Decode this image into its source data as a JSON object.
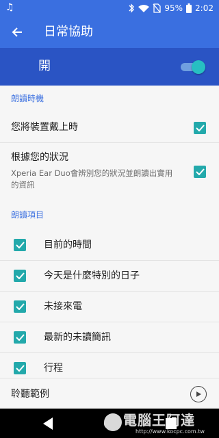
{
  "status_bar": {
    "battery": "95%",
    "time": "2:02",
    "icons": [
      "music-note-icon",
      "bluetooth-icon",
      "wifi-icon",
      "no-sim-icon",
      "battery-icon"
    ]
  },
  "app_bar": {
    "title": "日常協助",
    "back_icon": "arrow-left-icon"
  },
  "master_switch": {
    "label": "開",
    "state": "on"
  },
  "sections": {
    "timing": {
      "header": "朗讀時機",
      "rows": [
        {
          "title": "您將裝置戴上時",
          "checked": true
        },
        {
          "title": "根據您的狀況",
          "subtitle": "Xperia Ear Duo會辨別您的狀況並朗讀出實用的資訊",
          "checked": true
        }
      ]
    },
    "items": {
      "header": "朗讀項目",
      "rows": [
        {
          "label": "目前的時間",
          "checked": true
        },
        {
          "label": "今天是什麼特別的日子",
          "checked": true
        },
        {
          "label": "未接來電",
          "checked": true
        },
        {
          "label": "最新的未讀簡訊",
          "checked": true
        },
        {
          "label": "行程",
          "checked": true
        }
      ]
    }
  },
  "footer": {
    "label": "聆聽範例",
    "play_icon": "play-circle-icon"
  },
  "nav_bar": {
    "icons": [
      "back-triangle-icon",
      "home-circle-icon",
      "recents-square-icon"
    ]
  },
  "watermark": {
    "main": "電腦王阿達",
    "sub": "http://www.kocpc.com.tw"
  },
  "colors": {
    "app_bar": "#3a6fe0",
    "master_bar": "#2a54c4",
    "accent": "#23a9ab",
    "section_header": "#3a6fe0"
  }
}
